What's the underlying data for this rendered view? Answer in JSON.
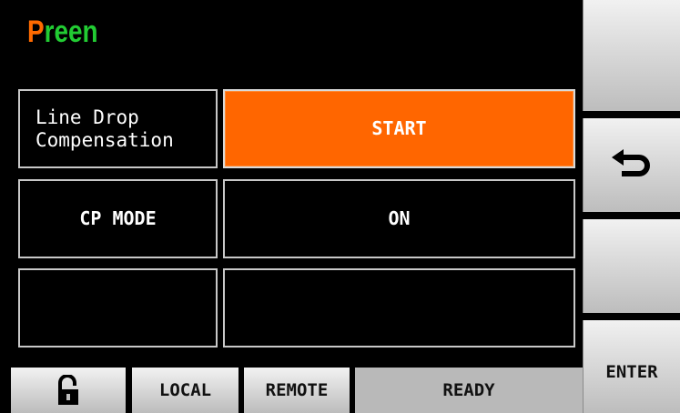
{
  "brand": {
    "first_letter": "P",
    "rest": "reen"
  },
  "rows": [
    {
      "label": "Line Drop\nCompensation",
      "value": "START",
      "active": true
    },
    {
      "label": "CP MODE",
      "value": "ON",
      "active": false
    },
    {
      "label": "",
      "value": "",
      "active": false
    }
  ],
  "softkeys": {
    "top_label": "",
    "back_icon": "return-arrow-icon",
    "third_label": "",
    "enter_label": "ENTER"
  },
  "status_bar": {
    "lock_icon": "unlocked-padlock-icon",
    "local_label": "LOCAL",
    "remote_label": "REMOTE",
    "state_label": "READY"
  },
  "colors": {
    "accent_orange": "#ff6600",
    "logo_orange": "#ff6a00",
    "logo_green": "#22cc33"
  }
}
